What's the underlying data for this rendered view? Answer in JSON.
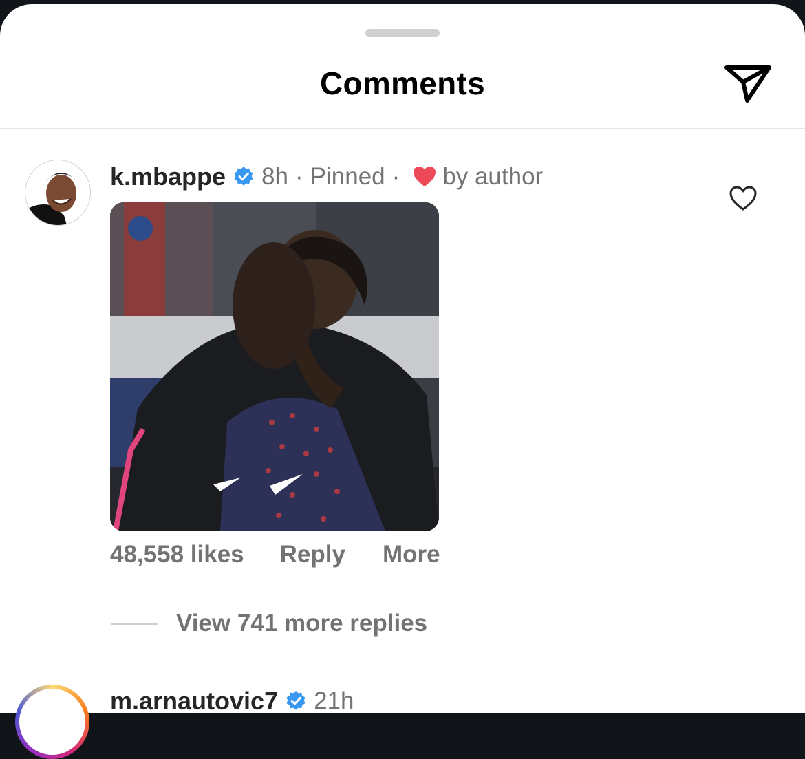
{
  "header": {
    "title": "Comments"
  },
  "comments": [
    {
      "username": "k.mbappe",
      "time": "8h",
      "separator": "·",
      "pinned": "Pinned",
      "liked_by_author": "by author",
      "likes": "48,558 likes",
      "reply": "Reply",
      "more": "More",
      "view_replies": "View 741 more replies"
    },
    {
      "username": "m.arnautovic7",
      "time": "21h"
    }
  ],
  "colors": {
    "verified": "#3897f0",
    "heart": "#ed4956",
    "secondary_text": "#737373",
    "primary_text": "#262626"
  },
  "icons": {
    "share": "paper-plane-icon",
    "like": "heart-outline-icon",
    "verified": "verified-badge-icon",
    "author_heart": "heart-filled-icon"
  }
}
